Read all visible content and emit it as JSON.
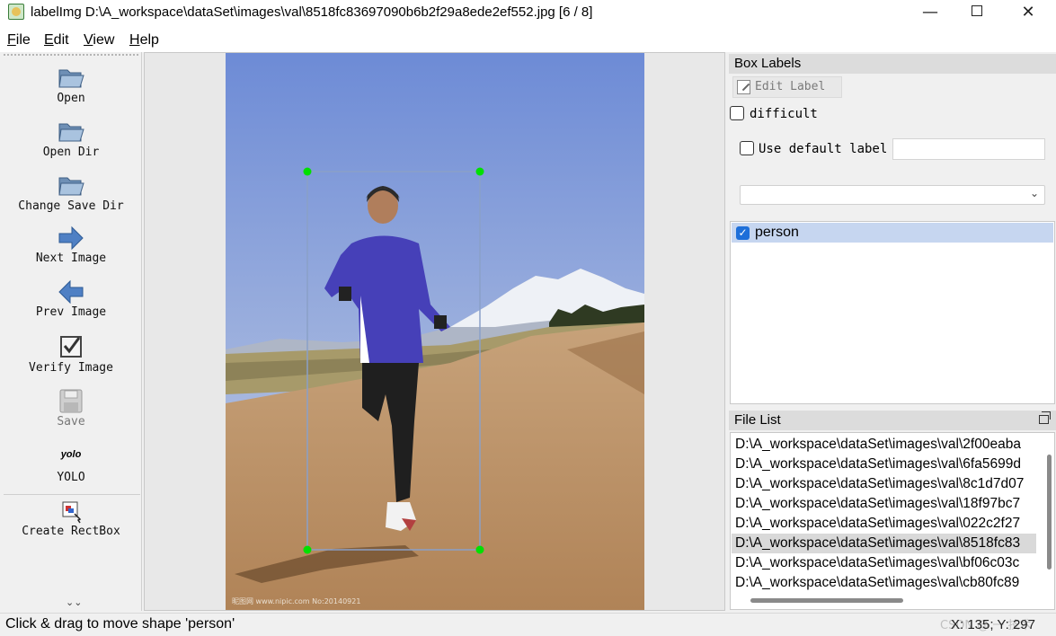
{
  "window": {
    "title": "labelImg D:\\A_workspace\\dataSet\\images\\val\\8518fc83697090b6b2f29a8ede2ef552.jpg [6 / 8]",
    "minimize": "—",
    "close": "✕"
  },
  "menu": [
    {
      "key": "F",
      "rest": "ile"
    },
    {
      "key": "E",
      "rest": "dit"
    },
    {
      "key": "V",
      "rest": "iew"
    },
    {
      "key": "H",
      "rest": "elp"
    }
  ],
  "toolbar": {
    "open": "Open",
    "open_dir": "Open Dir",
    "change_save_dir": "Change Save Dir",
    "next_image": "Next Image",
    "prev_image": "Prev Image",
    "verify_image": "Verify Image",
    "save": "Save",
    "yolo_icon_text": "yolo",
    "yolo": "YOLO",
    "create_rectbox": "Create RectBox",
    "more": "⌄⌄"
  },
  "canvas": {
    "photo_watermark": "昵图网 www.nipic.com   No:20140921",
    "box_label": "person"
  },
  "box_labels": {
    "title": "Box Labels",
    "edit_label": "Edit Label",
    "difficult": "difficult",
    "use_default_label": "Use default label",
    "default_label_value": "",
    "combo_value": "",
    "labels": [
      {
        "text": "person",
        "checked": true
      }
    ]
  },
  "file_list": {
    "title": "File List",
    "selected_index": 5,
    "items": [
      "D:\\A_workspace\\dataSet\\images\\val\\2f00eaba",
      "D:\\A_workspace\\dataSet\\images\\val\\6fa5699d",
      "D:\\A_workspace\\dataSet\\images\\val\\8c1d7d07",
      "D:\\A_workspace\\dataSet\\images\\val\\18f97bc7",
      "D:\\A_workspace\\dataSet\\images\\val\\022c2f27",
      "D:\\A_workspace\\dataSet\\images\\val\\8518fc83",
      "D:\\A_workspace\\dataSet\\images\\val\\bf06c03c",
      "D:\\A_workspace\\dataSet\\images\\val\\cb80fc89"
    ]
  },
  "status": {
    "message": "Click & drag to move shape 'person'",
    "coords": "X: 135; Y: 297",
    "watermark": "CSDN @ 一 技术"
  },
  "colors": {
    "box_corner": "#00e000",
    "box_border": "#8aa0c8",
    "selected_label_bg": "#c6d6f0",
    "selected_file_bg": "#d9d9d9"
  }
}
